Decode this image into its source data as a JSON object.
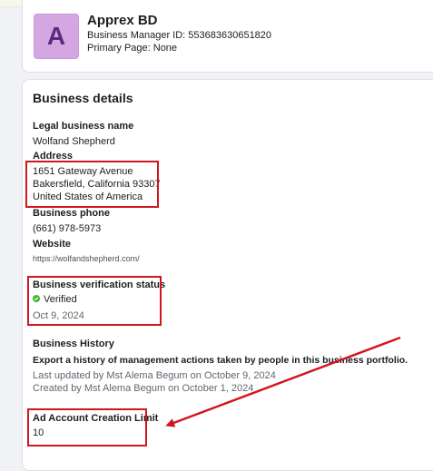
{
  "business": {
    "avatar_letter": "A",
    "name": "Apprex BD",
    "manager_id_label": "Business Manager ID: 553683630651820",
    "primary_page": "Primary Page: None"
  },
  "details": {
    "title": "Business details",
    "legal_name_label": "Legal business name",
    "legal_name": "Wolfand Shepherd",
    "address_label": "Address",
    "address_line1": "1651 Gateway Avenue",
    "address_line2": "Bakersfield, California 93307",
    "address_line3": "United States of America",
    "phone_label": "Business phone",
    "phone": "(661) 978-5973",
    "website_label": "Website",
    "website": "https://wolfandshepherd.com/",
    "verification_label": "Business verification status",
    "verification_status": "Verified",
    "verification_date": "Oct 9, 2024",
    "history_label": "Business History",
    "history_export": "Export a history of management actions taken by people in this business portfolio.",
    "last_updated": "Last updated by Mst Alema Begum on October 9, 2024",
    "created_by": "Created by Mst Alema Begum on October 1, 2024",
    "ad_limit_label": "Ad Account Creation Limit",
    "ad_limit_value": "10"
  },
  "colors": {
    "annotation_red": "#d0161e",
    "verified_green": "#42b72a",
    "avatar_bg": "#d4a6e2"
  }
}
